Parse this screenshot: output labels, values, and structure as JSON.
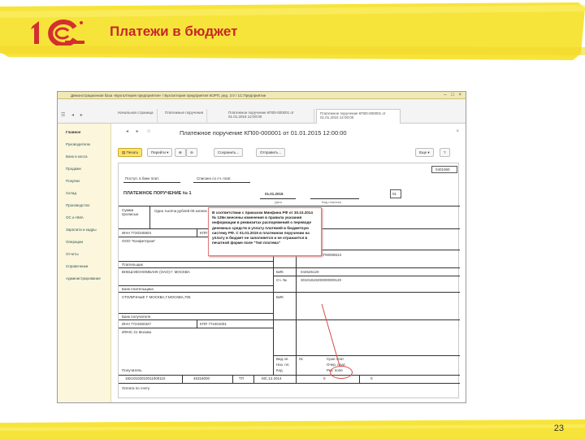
{
  "slide": {
    "title": "Платежи в бюджет",
    "page_number": "23",
    "colors": {
      "band": "#f7e43a",
      "title": "#c62828",
      "logo": "#d32f2f"
    }
  },
  "window": {
    "title": "Демонстрационная база «Бухгалтерия предприятия» / Бухгалтерия предприятия КОРП, ред. 3.0 / 1С:Предприятие",
    "tabs": [
      "Начальная страница",
      "Платежные поручения",
      "Платежное поручение КП00-000001 от 01.01.2015 12:00:00",
      "Платежное поручение КП00-000001 от 01.01.2015 12:00:00"
    ]
  },
  "sidebar": {
    "items": [
      "Главное",
      "Руководителю",
      "Банк и касса",
      "Продажи",
      "Покупки",
      "Склад",
      "Производство",
      "ОС и НМА",
      "Зарплата и кадры",
      "Операции",
      "Отчеты",
      "Справочники",
      "Администрирование"
    ]
  },
  "document": {
    "title": "Платежное поручение КП00-000001 от 01.01.2015 12:00:00",
    "toolbar": {
      "print": "Печать",
      "goto": "Перейти",
      "save": "Сохранить...",
      "send": "Отправить...",
      "more": "Еще",
      "help": "?"
    }
  },
  "form": {
    "code": "0401060",
    "received": "Поступ. в банк плат.",
    "debited": "Списано со сч. плат.",
    "heading": "ПЛАТЕЖНОЕ ПОРУЧЕНИЕ № 1",
    "date": "01.01.2015",
    "date_label": "Дата",
    "payment_type": "Вид платежа",
    "status": "01",
    "sum_words_label": "Сумма прописью",
    "sum_words": "Одна тысяча рублей 00 копеек",
    "inn_payer": "ИНН 7720345904",
    "kpp_payer": "КПП 772101001",
    "sum_label": "Сумма",
    "sum_value": "1000-00",
    "payer_name": "ООО \"Конфетпром\"",
    "account_label": "Сч. №",
    "payer_account": "40702810300700006513",
    "payer_label": "Плательщик",
    "payer_bank": "ВНЕШЭКОНОМБАНК (ОАО) Г. МОСКВА",
    "bik_label": "БИК",
    "bik_value": "044525120",
    "corr_account": "30101810200000000120",
    "payer_bank_label": "Банк плательщика",
    "recipient_bank": "СТОЛИЧНЫЕ Г МОСКВА,Г.МОСКВА,705",
    "recipient_bank_label": "Банк получателя",
    "inn_recipient": "ИНН 7724450327",
    "kpp_recipient": "КПП 772401001",
    "recipient_name": "ИФНС 21 Москва",
    "recipient_label": "Получатель",
    "kind_op_label": "Вид оп.",
    "kind_op_value": "01",
    "pay_term": "Срок плат.",
    "pay_order": "Очер. плат.",
    "purpose_code": "Наз. пл.",
    "res_field": "Рез. поле",
    "code_label": "Код",
    "kbk": "18210102010011000110",
    "oktmo": "45318000",
    "basis": "ТП",
    "tax_period": "МС.12.2014",
    "doc_num": "0",
    "doc_date": "0",
    "purpose_label": "Оплата по счету"
  },
  "callout": {
    "text": "В соответствии с приказом Минфина РФ от 30.10.2014 № 126н внесены изменения в правила указания информации в реквизитах распоряжений о переводе денежных средств в уплату платежей в бюджетную систему РФ. С 01.01.2015 в платежном поручении на уплату в бюджет не заполняется и не отражается в печатной форме поле \"Тип платежа\""
  }
}
